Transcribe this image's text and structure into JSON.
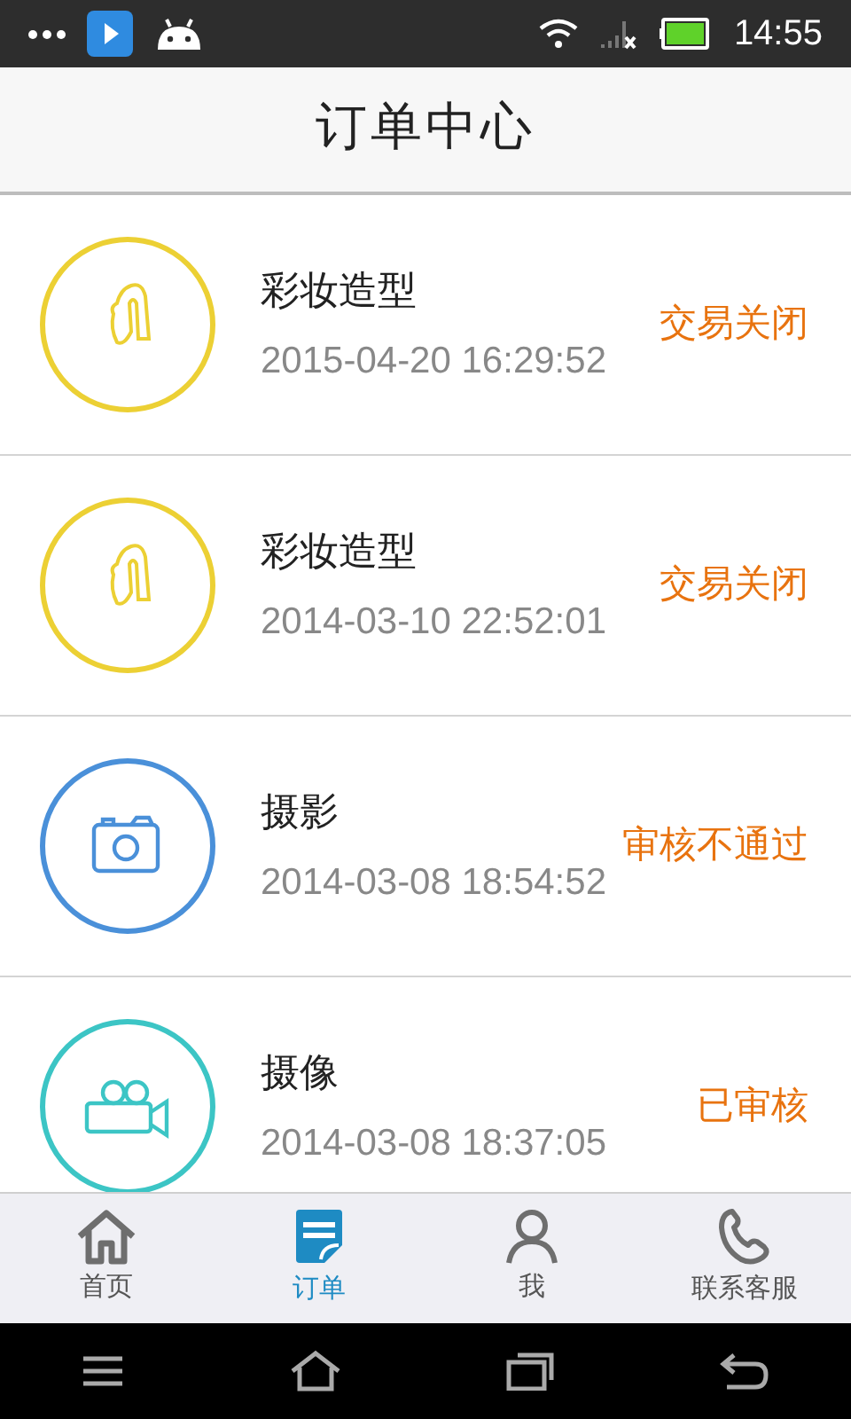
{
  "status_bar": {
    "time": "14:55"
  },
  "header": {
    "title": "订单中心"
  },
  "orders": [
    {
      "kind": "makeup",
      "color": "#ecd034",
      "name": "彩妆造型",
      "time": "2015-04-20 16:29:52",
      "status": "交易关闭"
    },
    {
      "kind": "makeup",
      "color": "#ecd034",
      "name": "彩妆造型",
      "time": "2014-03-10 22:52:01",
      "status": "交易关闭"
    },
    {
      "kind": "photo",
      "color": "#4a90d9",
      "name": "摄影",
      "time": "2014-03-08 18:54:52",
      "status": "审核不通过"
    },
    {
      "kind": "video",
      "color": "#3cc5c5",
      "name": "摄像",
      "time": "2014-03-08 18:37:05",
      "status": "已审核"
    }
  ],
  "tab_bar": [
    {
      "kind": "home",
      "label": "首页",
      "selected": false
    },
    {
      "kind": "orders",
      "label": "订单",
      "selected": true
    },
    {
      "kind": "me",
      "label": "我",
      "selected": false
    },
    {
      "kind": "phone",
      "label": "联系客服",
      "selected": false
    }
  ]
}
